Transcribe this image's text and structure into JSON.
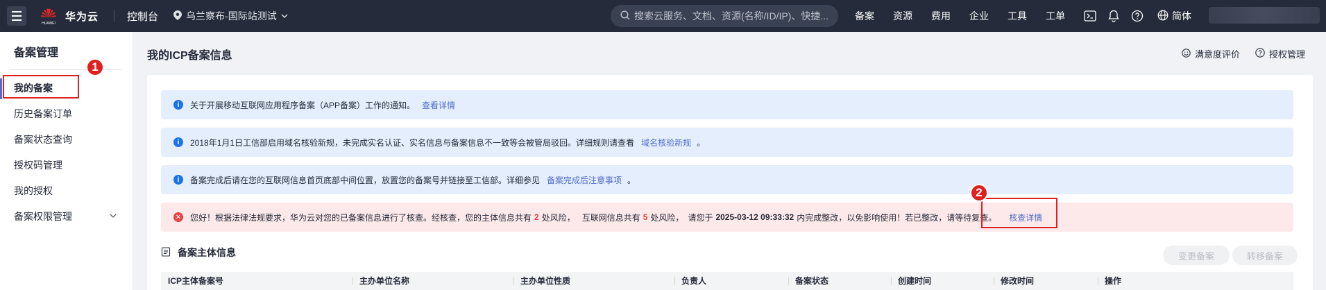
{
  "topbar": {
    "brand_name": "华为云",
    "brand_sub": "HUAWEI",
    "console_label": "控制台",
    "region": "乌兰察布-国际站测试",
    "search_placeholder": "搜索云服务、文档、资源(名称/ID/IP)、快捷...",
    "nav": [
      "备案",
      "资源",
      "费用",
      "企业",
      "工具",
      "工单"
    ],
    "language": "简体"
  },
  "sidebar": {
    "title": "备案管理",
    "items": [
      {
        "label": "我的备案",
        "active": true
      },
      {
        "label": "历史备案订单"
      },
      {
        "label": "备案状态查询"
      },
      {
        "label": "授权码管理"
      },
      {
        "label": "我的授权"
      },
      {
        "label": "备案权限管理",
        "expandable": true
      }
    ]
  },
  "main": {
    "title": "我的ICP备案信息",
    "links": {
      "rating": "满意度评价",
      "auth": "授权管理"
    },
    "notices": [
      {
        "text": "关于开展移动互联网应用程序备案（APP备案）工作的通知。",
        "link": "查看详情"
      },
      {
        "text": "2018年1月1日工信部启用域名核验新规，未完成实名认证、实名信息与备案信息不一致等会被管局驳回。详细规则请查看",
        "link": "域名核验新规",
        "suffix": "。"
      },
      {
        "text": "备案完成后请在您的互联网信息首页底部中间位置，放置您的备案号并链接至工信部。详细参见",
        "link": "备案完成后注意事项",
        "suffix": "。"
      }
    ],
    "risk_notice": {
      "part1": "您好！根据法律法规要求，华为云对您的已备案信息进行了核查。经核查，您的主体信息共有",
      "subject_risks": "2",
      "part2": "处风险，",
      "part3": "互联网信息共有",
      "web_risks": "5",
      "part4": "处风险，",
      "part5": "请您于",
      "deadline": "2025-03-12 09:33:32",
      "part6": "内完成整改，以免影响使用！若已整改，请等待复查。",
      "link": "核查详情"
    },
    "section_title": "备案主体信息",
    "buttons": {
      "change": "变更备案",
      "transfer": "转移备案"
    },
    "table_headers": [
      "ICP主体备案号",
      "主办单位名称",
      "主办单位性质",
      "负责人",
      "备案状态",
      "创建时间",
      "修改时间",
      "操作"
    ]
  },
  "annotations": {
    "badge1": "1",
    "badge2": "2"
  },
  "colors": {
    "topbar": "#252b3a",
    "link": "#526ecc",
    "info_bg": "#e4eefd",
    "error_bg": "#fde9e9",
    "annotation": "#e02020"
  }
}
